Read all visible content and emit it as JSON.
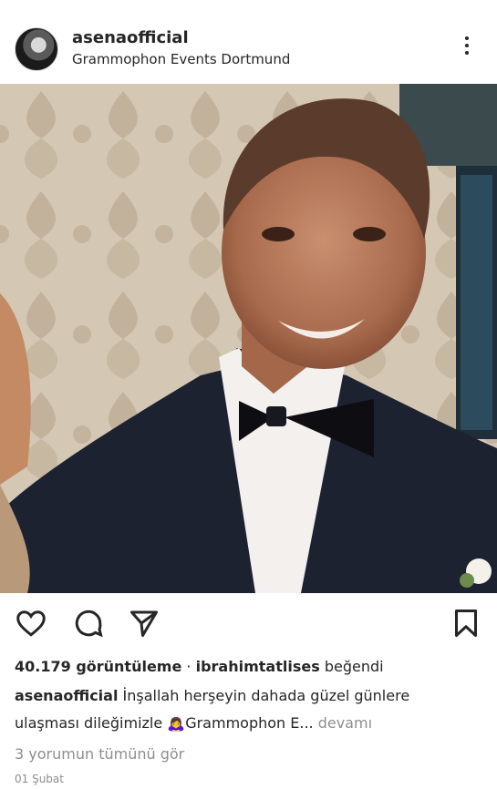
{
  "post": {
    "username": "asenaofficial",
    "location": "Grammophon Events Dortmund",
    "views": "40.179 görüntüleme",
    "separator": " · ",
    "liked_by": "ibrahimtatlises",
    "liked_suffix": " beğendi",
    "caption_user": "asenaofficial",
    "caption_line1": " İnşallah herşeyin dahada güzel günlere",
    "caption_line2": "ulaşması dileğimizle ",
    "caption_emoji": "🙇‍♀️",
    "caption_tail": "Grammophon E...",
    "more_label": " devamı",
    "comments_link": "3 yorumun tümünü gör",
    "date": "01 Şubat"
  },
  "icons": {
    "more": "more-options-icon",
    "like": "heart-icon",
    "comment": "comment-icon",
    "share": "send-icon",
    "save": "bookmark-icon"
  },
  "colors": {
    "text": "#262626",
    "muted": "#8e8e8e",
    "background": "#ffffff"
  }
}
